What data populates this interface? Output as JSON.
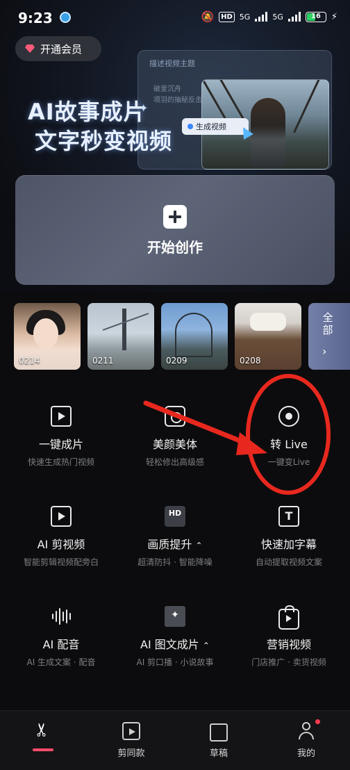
{
  "status_bar": {
    "time": "9:23",
    "hd_badge": "HD",
    "net1": "5G",
    "net2": "5G",
    "battery": "16"
  },
  "vip_button": {
    "label": "开通会员"
  },
  "promo": {
    "title_line1": "AI故事成片",
    "title_line2": "文字秒变视频",
    "panel_title": "描述视频主题",
    "panel_line1": "破釜沉舟",
    "panel_line2": "项羽的抽秘反击",
    "generate_label": "生成视频"
  },
  "create": {
    "label": "开始创作"
  },
  "recent": {
    "items": [
      {
        "date": "0214"
      },
      {
        "date": "0211"
      },
      {
        "date": "0209"
      },
      {
        "date": "0208"
      }
    ],
    "more_label": "全部"
  },
  "tools": [
    {
      "name": "一键成片",
      "desc": "快速生成热门视频",
      "icon": "video-spark-icon"
    },
    {
      "name": "美颜美体",
      "desc": "轻松修出高级感",
      "icon": "beauty-camera-icon"
    },
    {
      "name": "转 Live",
      "desc": "一键变Live",
      "icon": "live-photo-icon"
    },
    {
      "name": "AI 剪视频",
      "desc": "智能剪辑视频配旁白",
      "icon": "ai-clip-icon"
    },
    {
      "name": "画质提升",
      "desc": "超清防抖 · 智能降噪",
      "icon": "hd-icon",
      "badge": "HD"
    },
    {
      "name": "快速加字幕",
      "desc": "自动提取视频文案",
      "icon": "subtitle-icon",
      "badge": "T"
    },
    {
      "name": "AI 配音",
      "desc": "AI 生成文案 · 配音",
      "icon": "voice-wave-icon"
    },
    {
      "name": "AI 图文成片",
      "desc": "AI 剪口播 · 小说故事",
      "icon": "image-text-folder-icon",
      "badge": "✦"
    },
    {
      "name": "营销视频",
      "desc": "门店推广 · 卖货视频",
      "icon": "marketing-bag-icon"
    }
  ],
  "tabbar": {
    "tabs": [
      {
        "label": "",
        "icon": "scissors-icon",
        "active": true
      },
      {
        "label": "剪同款",
        "icon": "template-film-icon"
      },
      {
        "label": "草稿",
        "icon": "drafts-folder-icon"
      },
      {
        "label": "我的",
        "icon": "profile-icon"
      }
    ]
  },
  "colors": {
    "accent": "#ff4b6b",
    "annotation": "#e8281e"
  }
}
